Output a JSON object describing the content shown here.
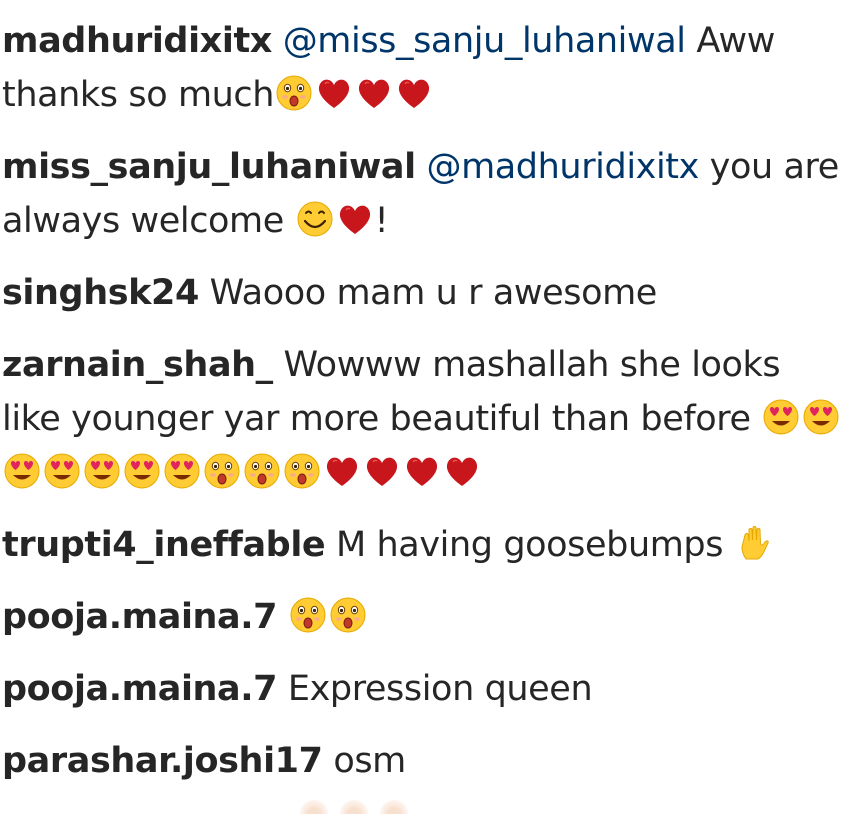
{
  "comments": [
    {
      "user": "madhuridixitx",
      "mention": "@miss_sanju_luhaniwal",
      "text": "Aww thanks so much",
      "tail": ""
    },
    {
      "user": "miss_sanju_luhaniwal",
      "mention": "@madhuridixitx",
      "text": "you are always welcome",
      "tail": "!"
    },
    {
      "user": "singhsk24",
      "text": "Waooo mam u r awesome"
    },
    {
      "user": "zarnain_shah_",
      "text": "Wowww mashallah she looks like younger yar more beautiful than before"
    },
    {
      "user": "trupti4_ineffable",
      "text": "M having goosebumps"
    },
    {
      "user": "pooja.maina.7",
      "text": ""
    },
    {
      "user": "pooja.maina.7",
      "text": "Expression queen"
    },
    {
      "user": "parashar.joshi17",
      "text": "osm"
    }
  ],
  "colors": {
    "username": "#262626",
    "text": "#262626",
    "mention": "#003569",
    "heart": "#c8161d",
    "emoji_face": "#ffcc33"
  },
  "icons": [
    "astonished-face-icon",
    "red-heart-icon",
    "smiling-face-icon",
    "heart-eyes-face-icon",
    "hand-icon"
  ]
}
